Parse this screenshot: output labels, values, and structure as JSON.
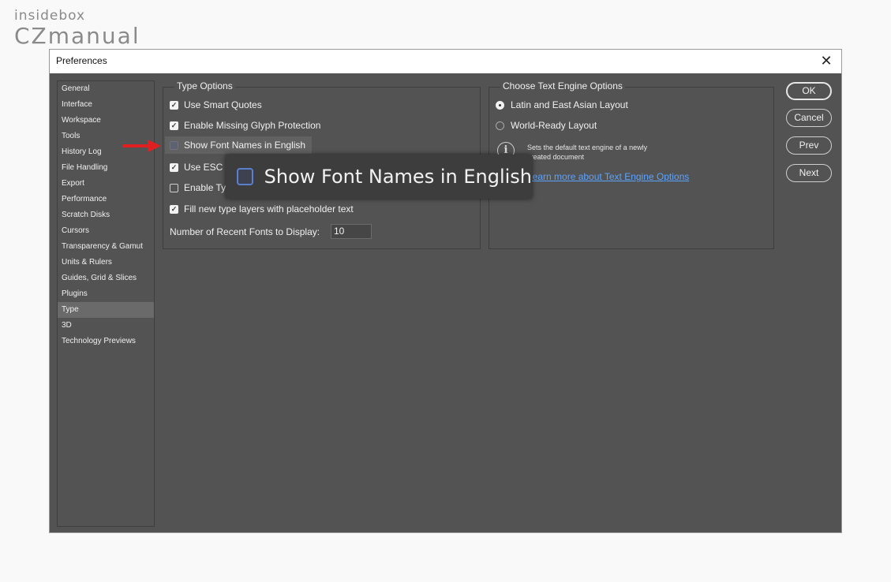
{
  "brand": {
    "line1": "insidebox",
    "line2": "CZmanual"
  },
  "window": {
    "title": "Preferences",
    "close_label": "✕"
  },
  "nav": {
    "items": [
      {
        "label": "General"
      },
      {
        "label": "Interface"
      },
      {
        "label": "Workspace"
      },
      {
        "label": "Tools"
      },
      {
        "label": "History Log"
      },
      {
        "label": "File Handling"
      },
      {
        "label": "Export"
      },
      {
        "label": "Performance"
      },
      {
        "label": "Scratch Disks"
      },
      {
        "label": "Cursors"
      },
      {
        "label": "Transparency & Gamut"
      },
      {
        "label": "Units & Rulers"
      },
      {
        "label": "Guides, Grid & Slices"
      },
      {
        "label": "Plugins"
      },
      {
        "label": "Type",
        "selected": true
      },
      {
        "label": "3D"
      },
      {
        "label": "Technology Previews"
      }
    ]
  },
  "type_options": {
    "title": "Type Options",
    "smart_quotes": {
      "label": "Use Smart Quotes",
      "checked": true
    },
    "missing_glyph": {
      "label": "Enable Missing Glyph Protection",
      "checked": true
    },
    "font_names_english": {
      "label": "Show Font Names in English",
      "checked": false
    },
    "use_esc": {
      "label": "Use ESC",
      "checked": true
    },
    "enable_ty": {
      "label": "Enable Ty",
      "checked": false
    },
    "fill_placeholder": {
      "label": "Fill new type layers with placeholder text",
      "checked": true
    },
    "recent_fonts": {
      "label": "Number of Recent Fonts to Display:",
      "value": "10"
    }
  },
  "text_engine": {
    "title": "Choose Text Engine Options",
    "latin_east_asian": {
      "label": "Latin and East Asian Layout",
      "selected": true
    },
    "world_ready": {
      "label": "World-Ready Layout",
      "selected": false
    },
    "info_text": "Sets the default text engine of a newly created document",
    "learn_more": "Learn more about Text Engine Options"
  },
  "buttons": {
    "ok": "OK",
    "cancel": "Cancel",
    "prev": "Prev",
    "next": "Next"
  },
  "zoom_callout": {
    "label": "Show Font Names in English"
  },
  "colors": {
    "dialog_bg": "#535353",
    "link": "#5aa3ff",
    "arrow": "#e02020"
  }
}
